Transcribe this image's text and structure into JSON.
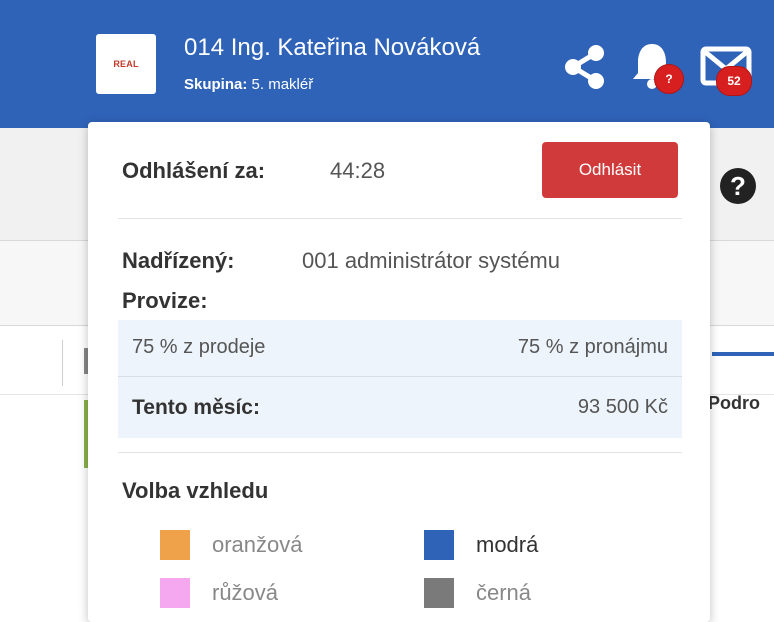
{
  "header": {
    "logo_text": "REAL",
    "user_name": "014 Ing. Kateřina Nováková",
    "group_label": "Skupina:",
    "group_value": "5. makléř",
    "notifications_badge": "?",
    "messages_badge": "52"
  },
  "background": {
    "partial_tab_text": "Podro"
  },
  "panel": {
    "logout_label": "Odhlášení za:",
    "logout_timer": "44:28",
    "logout_button": "Odhlásit",
    "supervisor_label": "Nadřízený:",
    "supervisor_value": "001 administrátor systému",
    "commission_label": "Provize:",
    "commission_sale": "75 % z prodeje",
    "commission_rent": "75 % z pronájmu",
    "this_month_label": "Tento měsíc:",
    "this_month_value": "93 500 Kč",
    "theme_title": "Volba vzhledu",
    "themes": [
      {
        "label": "oranžová",
        "color": "#f0a24a"
      },
      {
        "label": "modrá",
        "color": "#2f63b8"
      },
      {
        "label": "růžová",
        "color": "#f5a8f0"
      },
      {
        "label": "černá",
        "color": "#7a7a7a"
      }
    ]
  }
}
